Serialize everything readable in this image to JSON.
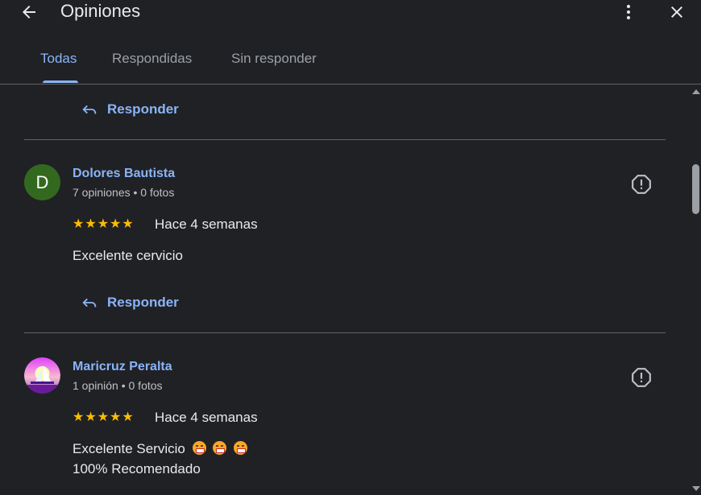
{
  "header": {
    "title": "Opiniones",
    "tabs": [
      {
        "label": "Todas",
        "active": true
      },
      {
        "label": "Respondidas",
        "active": false
      },
      {
        "label": "Sin responder",
        "active": false
      }
    ]
  },
  "reply_label": "Responder",
  "reviews": [
    {
      "avatar_letter": "D",
      "name": "Dolores Bautista",
      "meta": "7 opiniones • 0 fotos",
      "rating": 5,
      "date": "Hace 4 semanas",
      "text_line1": "Excelente cervicio"
    },
    {
      "name": "Maricruz Peralta",
      "meta": "1 opinión • 0 fotos",
      "rating": 5,
      "date": "Hace 4 semanas",
      "text_line1": "Excelente Servicio",
      "text_line2": "100% Recomendado"
    }
  ],
  "colors": {
    "background": "#202124",
    "accent": "#8ab4f8",
    "star": "#fbbc04",
    "avatar_d": "#33691e"
  },
  "icons": {
    "back": "arrow-left-icon",
    "more": "more-vert-icon",
    "close": "close-icon",
    "reply": "reply-icon",
    "flag": "report-icon"
  }
}
